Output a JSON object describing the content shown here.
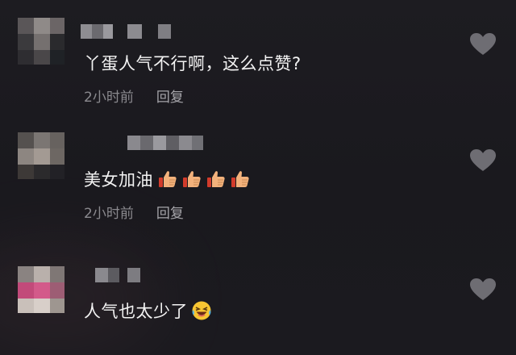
{
  "comments": [
    {
      "text": "丫蛋人气不行啊，这么点赞?",
      "time": "2小时前",
      "reply": "回复",
      "like_icon": "heart-outline-icon"
    },
    {
      "text": "美女加油",
      "emojis": [
        "thumbs-up",
        "thumbs-up",
        "thumbs-up",
        "thumbs-up"
      ],
      "time": "2小时前",
      "reply": "回复",
      "like_icon": "heart-outline-icon"
    },
    {
      "text": "人气也太少了",
      "emojis": [
        "laughing-crying"
      ],
      "like_icon": "heart-outline-icon"
    }
  ],
  "colors": {
    "background": "#1b1a1f",
    "text": "#f3f3f3",
    "meta": "#8a898e",
    "heart": "#6e6d73"
  }
}
